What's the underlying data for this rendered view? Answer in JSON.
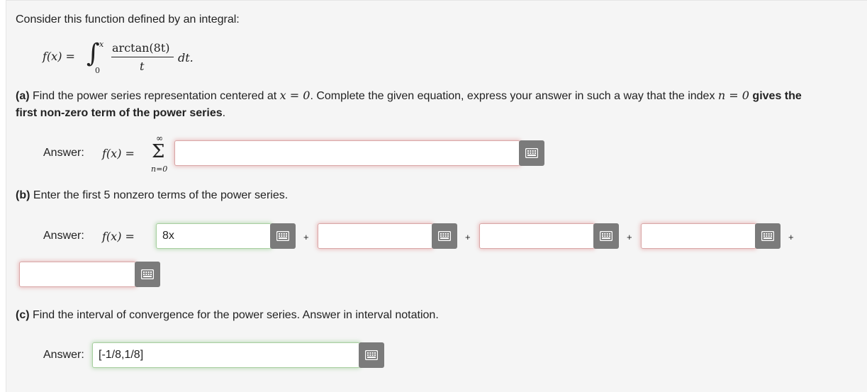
{
  "intro": "Consider this function defined by an integral:",
  "definition": {
    "lhs": "f(x) =",
    "upper": "x",
    "lower": "0",
    "numerator": "arctan(8t)",
    "denominator": "t",
    "dt": "dt."
  },
  "part_a": {
    "label": "(a)",
    "text_1": "Find the power series representation centered at",
    "cond": "x = 0",
    "text_2": ". Complete the given equation, express your answer in such a way that the index",
    "index_eq": "n = 0",
    "bold_1": "gives the",
    "bold_2": "first non-zero term of the power series",
    "period": ".",
    "answer_label": "Answer:",
    "lhs": "f(x) =",
    "sigma": "Σ",
    "sigma_upper": "∞",
    "sigma_lower": "n=0",
    "field_value": ""
  },
  "part_b": {
    "label": "(b)",
    "text": "Enter the first 5 nonzero terms of the power series.",
    "answer_label": "Answer:",
    "lhs": "f(x) =",
    "terms": [
      "8x",
      "",
      "",
      "",
      ""
    ],
    "plus": "+"
  },
  "part_c": {
    "label": "(c)",
    "text": "Find the interval of convergence for the power series. Answer in interval notation.",
    "answer_label": "Answer:",
    "field_value": "[-1/8,1/8]"
  },
  "colors": {
    "invalid_glow": "#d9a7a7",
    "valid_glow": "#a8cfa0",
    "keyboard_button": "#7b7b7b"
  },
  "icons": {
    "keyboard": "keyboard-icon"
  }
}
